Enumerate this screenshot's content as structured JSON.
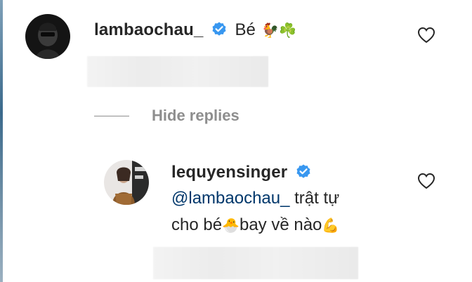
{
  "comment": {
    "username": "lambaochau_",
    "text": "Bé",
    "emojis": "🐓☘️"
  },
  "replies_toggle": {
    "label": "Hide replies"
  },
  "reply": {
    "username": "lequyensinger",
    "mention": "@lambaochau_",
    "text_line1": " trật tự",
    "text_line2_a": "cho bé",
    "emoji_chick": "🐣",
    "text_line2_b": "bay về nào",
    "emoji_muscle": "💪"
  },
  "colors": {
    "text": "#262626",
    "secondary": "#8e8e8e",
    "mention": "#00376b",
    "verified": "#3897f0"
  }
}
